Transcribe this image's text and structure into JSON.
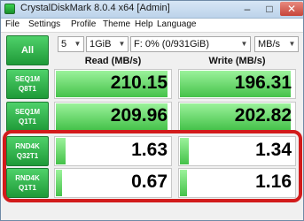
{
  "window": {
    "title": "CrystalDiskMark 8.0.4 x64 [Admin]"
  },
  "menu": [
    "File",
    "Settings",
    "Profile",
    "Theme",
    "Help",
    "Language"
  ],
  "toolbar": {
    "all_label": "All",
    "count": "5",
    "size": "1GiB",
    "drive": "F: 0% (0/931GiB)",
    "unit": "MB/s"
  },
  "columns": {
    "read": "Read (MB/s)",
    "write": "Write (MB/s)"
  },
  "rows": [
    {
      "label1": "SEQ1M",
      "label2": "Q8T1",
      "read": "210.15",
      "write": "196.31",
      "read_fill": 0.98,
      "write_fill": 0.97
    },
    {
      "label1": "SEQ1M",
      "label2": "Q1T1",
      "read": "209.96",
      "write": "202.82",
      "read_fill": 0.98,
      "write_fill": 0.97
    },
    {
      "label1": "RND4K",
      "label2": "Q32T1",
      "read": "1.63",
      "write": "1.34",
      "read_fill": 0.1,
      "write_fill": 0.09
    },
    {
      "label1": "RND4K",
      "label2": "Q1T1",
      "read": "0.67",
      "write": "1.16",
      "read_fill": 0.07,
      "write_fill": 0.08
    }
  ],
  "colors": {
    "accent_green": "#2fb54a",
    "bar_green": "#7ee07f",
    "highlight_red": "#d21b1b"
  }
}
